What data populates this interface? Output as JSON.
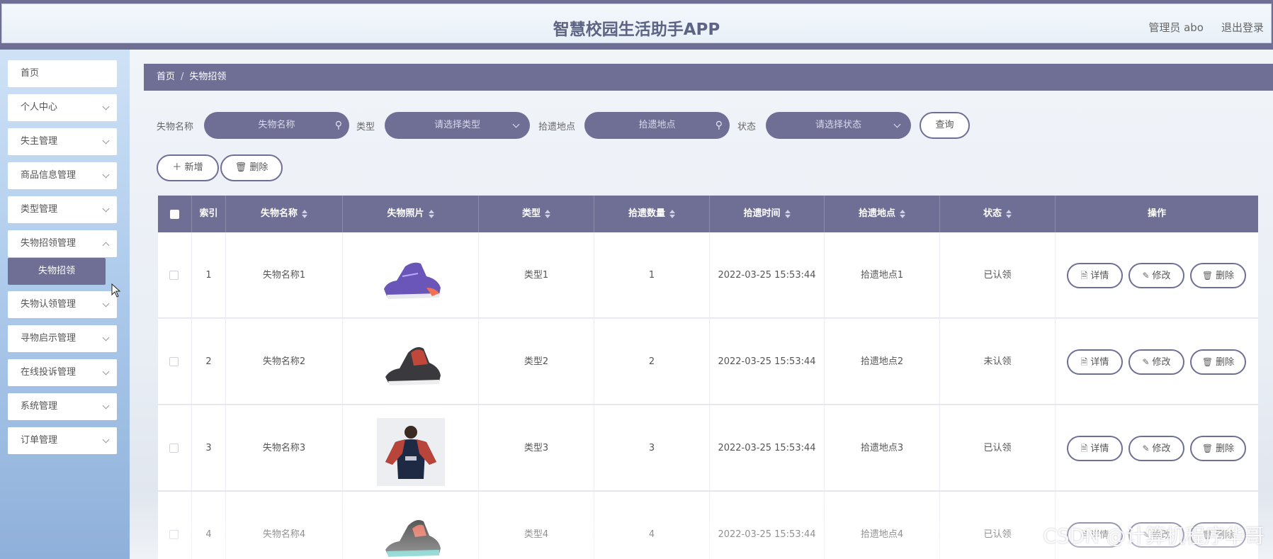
{
  "header": {
    "title": "智慧校园生活助手APP",
    "user": "管理员 abo",
    "logout": "退出登录"
  },
  "sidebar": {
    "items": [
      {
        "label": "首页",
        "has_arrow": false
      },
      {
        "label": "个人中心",
        "has_arrow": true
      },
      {
        "label": "失主管理",
        "has_arrow": true
      },
      {
        "label": "商品信息管理",
        "has_arrow": true
      },
      {
        "label": "类型管理",
        "has_arrow": true
      },
      {
        "label": "失物招领管理",
        "has_arrow": true
      },
      {
        "label": "失物认领管理",
        "has_arrow": true
      },
      {
        "label": "寻物启示管理",
        "has_arrow": true
      },
      {
        "label": "在线投诉管理",
        "has_arrow": true
      },
      {
        "label": "系统管理",
        "has_arrow": true
      },
      {
        "label": "订单管理",
        "has_arrow": true
      }
    ],
    "active_sub": "失物招领"
  },
  "breadcrumb": {
    "home": "首页",
    "sep": "/",
    "current": "失物招领"
  },
  "filters": {
    "name_label": "失物名称",
    "name_placeholder": "失物名称",
    "type_label": "类型",
    "type_placeholder": "请选择类型",
    "location_label": "拾遗地点",
    "location_placeholder": "拾遗地点",
    "status_label": "状态",
    "status_placeholder": "请选择状态",
    "query": "查询"
  },
  "actions": {
    "add": "新增",
    "delete": "删除"
  },
  "table": {
    "columns": [
      "索引",
      "失物名称",
      "失物照片",
      "类型",
      "拾遗数量",
      "拾遗时间",
      "拾遗地点",
      "状态",
      "操作"
    ],
    "rows": [
      {
        "index": "1",
        "name": "失物名称1",
        "photo": "purple-sneaker",
        "type": "类型1",
        "qty": "1",
        "time": "2022-03-25 15:53:44",
        "location": "拾遗地点1",
        "status": "已认领"
      },
      {
        "index": "2",
        "name": "失物名称2",
        "photo": "red-sneaker",
        "type": "类型2",
        "qty": "2",
        "time": "2022-03-25 15:53:44",
        "location": "拾遗地点2",
        "status": "未认领"
      },
      {
        "index": "3",
        "name": "失物名称3",
        "photo": "sweater-photo",
        "type": "类型3",
        "qty": "3",
        "time": "2022-03-25 15:53:44",
        "location": "拾遗地点3",
        "status": "已认领"
      },
      {
        "index": "4",
        "name": "失物名称4",
        "photo": "teal-sneaker",
        "type": "类型4",
        "qty": "4",
        "time": "2022-03-25 15:53:44",
        "location": "拾遗地点4",
        "status": "已认领"
      }
    ],
    "ops": {
      "detail": "详情",
      "edit": "修改",
      "delete": "删除"
    }
  },
  "watermark": "CSDN @计算机程序华哥",
  "colors": {
    "accent": "#6f6f96",
    "sidebar_top": "#cfe2f6",
    "sidebar_bottom": "#8fb0da"
  }
}
